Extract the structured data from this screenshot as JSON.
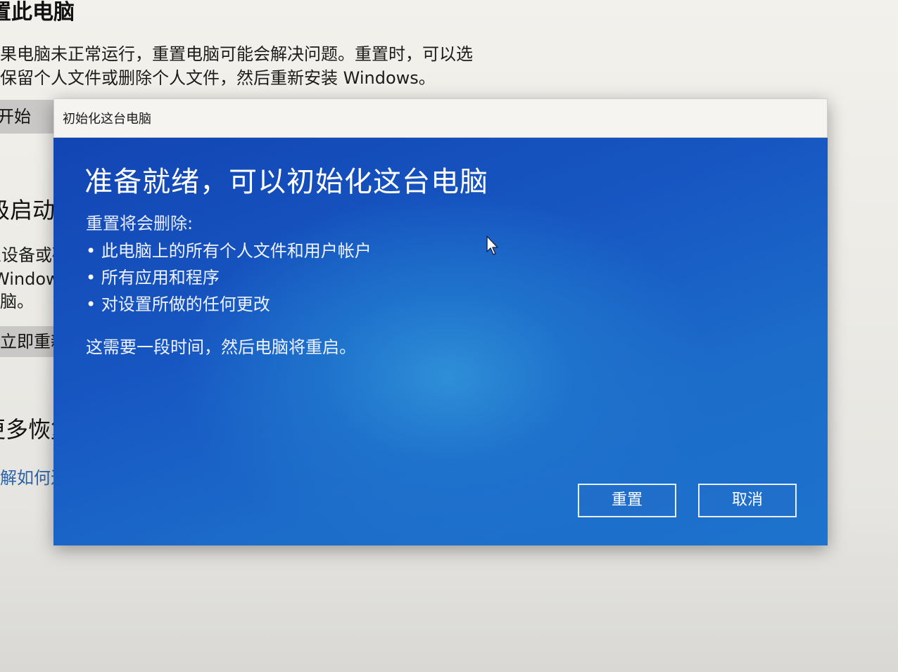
{
  "background": {
    "section_title": "重置此电脑",
    "description_line1": "如果电脑未正常运行，重置电脑可能会解决问题。重置时，可以选",
    "description_line2": "择保留个人文件或删除个人文件，然后重新安装 Windows。",
    "start_button": "开始",
    "advanced_title": "高级启动",
    "advanced_line1": "从设备或磁",
    "advanced_line2": "Windows",
    "advanced_line3": "电脑。",
    "restart_button": "立即重新启",
    "more_title": "更多恢复选",
    "more_link": "了解如何进行"
  },
  "dialog": {
    "title": "初始化这台电脑",
    "heading": "准备就绪，可以初始化这台电脑",
    "subheading": "重置将会删除:",
    "bullets": [
      "此电脑上的所有个人文件和用户帐户",
      "所有应用和程序",
      "对设置所做的任何更改"
    ],
    "note": "这需要一段时间，然后电脑将重启。",
    "reset_button": "重置",
    "cancel_button": "取消"
  },
  "colors": {
    "dialog_blue": "#1757c2",
    "titlebar": "#f5f4f1",
    "link": "#2b63a8"
  },
  "icons": {
    "cursor": "mouse-pointer-icon"
  }
}
